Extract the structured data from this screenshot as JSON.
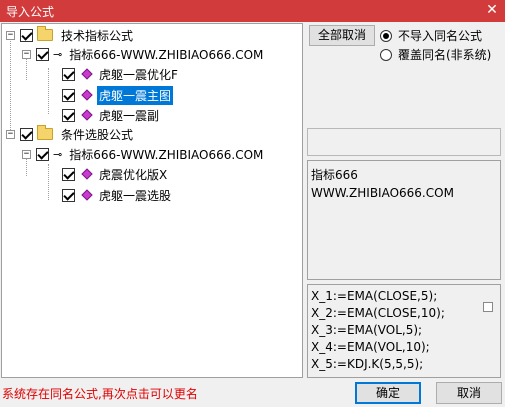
{
  "window": {
    "title": "导入公式",
    "close_glyph": "✕"
  },
  "tree": {
    "groups": [
      {
        "label": "技术指标公式",
        "source": "指标666-WWW.ZHIBIAO666.COM",
        "items": [
          "虎躯一震优化F",
          "虎躯一震主图",
          "虎躯一震副"
        ]
      },
      {
        "label": "条件选股公式",
        "source": "指标666-WWW.ZHIBIAO666.COM",
        "items": [
          "虎震优化版X",
          "虎躯一震选股"
        ]
      }
    ],
    "selected_item": "虎躯一震主图"
  },
  "options": {
    "cancel_all_label": "全部取消",
    "radio_no_import": "不导入同名公式",
    "radio_overwrite": "覆盖同名(非系统)",
    "selected": "不导入同名公式"
  },
  "description": {
    "line1": "指标666",
    "line2": "WWW.ZHIBIAO666.COM"
  },
  "code": {
    "lines": [
      "X_1:=EMA(CLOSE,5);",
      "X_2:=EMA(CLOSE,10);",
      "X_3:=EMA(VOL,5);",
      "X_4:=EMA(VOL,10);",
      "X_5:=KDJ.K(5,5,5);"
    ]
  },
  "status_message": "系统存在同名公式,再次点击可以更名",
  "buttons": {
    "ok": "确定",
    "cancel": "取消"
  },
  "colors": {
    "titlebar": "#d23b3b",
    "selection": "#0078d7",
    "status_text": "#e00000"
  }
}
